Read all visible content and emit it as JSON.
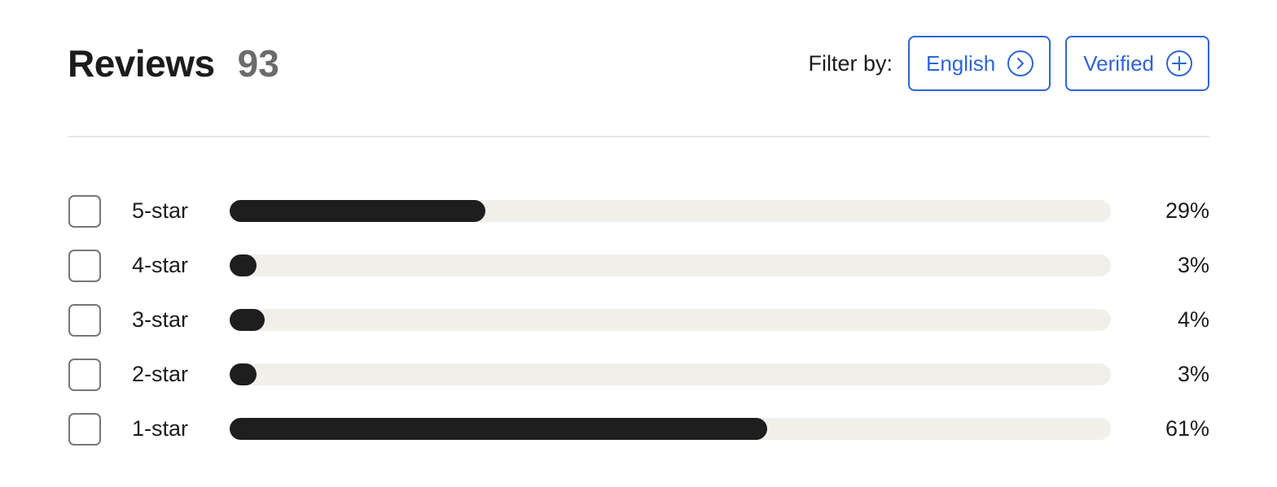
{
  "header": {
    "title": "Reviews",
    "count": "93",
    "filter_label": "Filter by:",
    "filters": [
      {
        "label": "English",
        "icon": "chevron-right-circle-icon"
      },
      {
        "label": "Verified",
        "icon": "plus-circle-icon"
      }
    ]
  },
  "colors": {
    "accent": "#2f64d8",
    "bar_fill": "#1e1e1e",
    "bar_track": "#f0efea",
    "count": "#6b6b6b"
  },
  "ratings": [
    {
      "label": "5-star",
      "percent_text": "29%",
      "percent": 29,
      "checked": false
    },
    {
      "label": "4-star",
      "percent_text": "3%",
      "percent": 3,
      "checked": false
    },
    {
      "label": "3-star",
      "percent_text": "4%",
      "percent": 4,
      "checked": false
    },
    {
      "label": "2-star",
      "percent_text": "3%",
      "percent": 3,
      "checked": false
    },
    {
      "label": "1-star",
      "percent_text": "61%",
      "percent": 61,
      "checked": false
    }
  ]
}
